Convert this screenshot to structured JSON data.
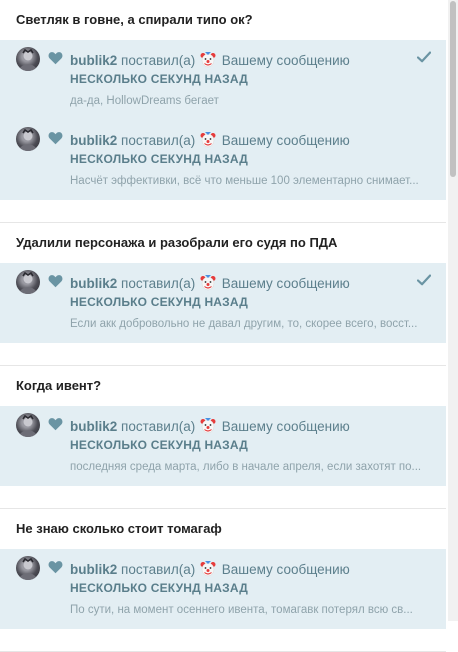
{
  "icons": {
    "heart": "heart-icon",
    "clown": "clown-face-icon",
    "check": "checkmark-icon"
  },
  "colors": {
    "notification_bg": "#e3eef3",
    "accent": "#5a7e8b",
    "preview_text": "#8fa3ab"
  },
  "groups": [
    {
      "title": "Светляк в говне, а спирали типо ок?",
      "notifications": [
        {
          "user": "bublik2",
          "action": "поставил(а)",
          "target": "Вашему сообщению",
          "time": "НЕСКОЛЬКО СЕКУНД НАЗАД",
          "preview": "да-да, HollowDreams бегает",
          "checked": true
        },
        {
          "user": "bublik2",
          "action": "поставил(а)",
          "target": "Вашему сообщению",
          "time": "НЕСКОЛЬКО СЕКУНД НАЗАД",
          "preview": "Насчёт эффективки, всё что меньше 100 элементарно снимает...",
          "checked": false
        }
      ]
    },
    {
      "title": "Удалили персонажа и разобрали его судя по ПДА",
      "notifications": [
        {
          "user": "bublik2",
          "action": "поставил(а)",
          "target": "Вашему сообщению",
          "time": "НЕСКОЛЬКО СЕКУНД НАЗАД",
          "preview": "Если акк добровольно не давал другим, то, скорее всего, восст...",
          "checked": true
        }
      ]
    },
    {
      "title": "Когда ивент?",
      "notifications": [
        {
          "user": "bublik2",
          "action": "поставил(а)",
          "target": "Вашему сообщению",
          "time": "НЕСКОЛЬКО СЕКУНД НАЗАД",
          "preview": "последняя среда марта, либо в начале апреля, если захотят по...",
          "checked": false
        }
      ]
    },
    {
      "title": "Не знаю сколько стоит томагаф",
      "notifications": [
        {
          "user": "bublik2",
          "action": "поставил(а)",
          "target": "Вашему сообщению",
          "time": "НЕСКОЛЬКО СЕКУНД НАЗАД",
          "preview": "По сути, на момент осеннего ивента, томагавк потерял всю св...",
          "checked": false
        }
      ]
    }
  ]
}
